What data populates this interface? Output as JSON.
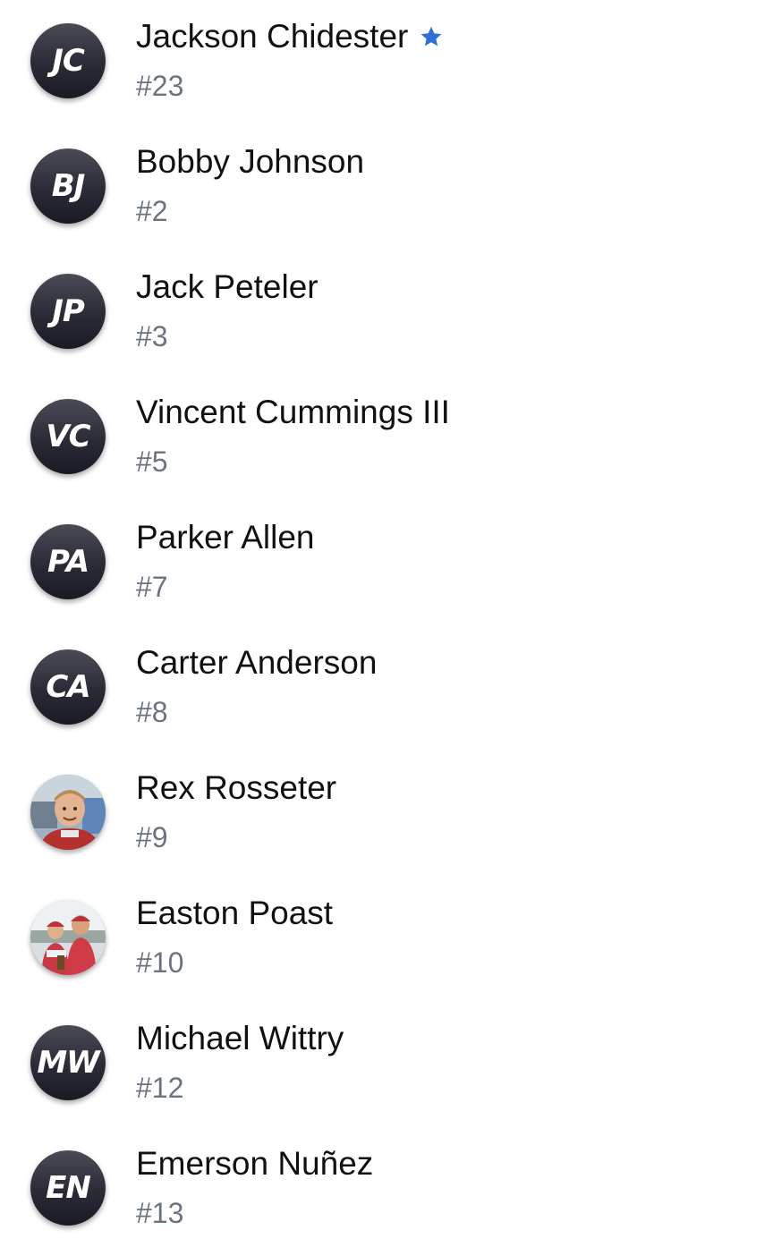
{
  "players": [
    {
      "initials": "JC",
      "name": "Jackson Chidester",
      "number": "#23",
      "starred": true,
      "avatar": "initials"
    },
    {
      "initials": "BJ",
      "name": "Bobby Johnson",
      "number": "#2",
      "starred": false,
      "avatar": "initials"
    },
    {
      "initials": "JP",
      "name": "Jack Peteler",
      "number": "#3",
      "starred": false,
      "avatar": "initials"
    },
    {
      "initials": "VC",
      "name": "Vincent Cummings III",
      "number": "#5",
      "starred": false,
      "avatar": "initials"
    },
    {
      "initials": "PA",
      "name": "Parker Allen",
      "number": "#7",
      "starred": false,
      "avatar": "initials"
    },
    {
      "initials": "CA",
      "name": "Carter Anderson",
      "number": "#8",
      "starred": false,
      "avatar": "initials"
    },
    {
      "initials": "",
      "name": "Rex Rosseter",
      "number": "#9",
      "starred": false,
      "avatar": "photo"
    },
    {
      "initials": "",
      "name": "Easton Poast",
      "number": "#10",
      "starred": false,
      "avatar": "photo"
    },
    {
      "initials": "MW",
      "name": "Michael Wittry",
      "number": "#12",
      "starred": false,
      "avatar": "initials"
    },
    {
      "initials": "EN",
      "name": "Emerson Nuñez",
      "number": "#13",
      "starred": false,
      "avatar": "initials"
    }
  ],
  "colors": {
    "avatar_bg": "#2a2b36",
    "name_text": "#111111",
    "number_text": "#6b7480",
    "star": "#2f6fd6"
  },
  "icons": {
    "favorite": "star-icon"
  }
}
